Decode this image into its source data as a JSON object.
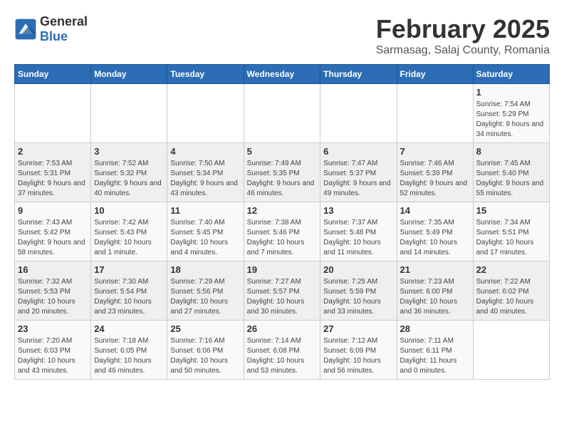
{
  "header": {
    "logo": {
      "general": "General",
      "blue": "Blue"
    },
    "title": "February 2025",
    "location": "Sarmasag, Salaj County, Romania"
  },
  "calendar": {
    "days_of_week": [
      "Sunday",
      "Monday",
      "Tuesday",
      "Wednesday",
      "Thursday",
      "Friday",
      "Saturday"
    ],
    "weeks": [
      [
        {
          "day": "",
          "info": ""
        },
        {
          "day": "",
          "info": ""
        },
        {
          "day": "",
          "info": ""
        },
        {
          "day": "",
          "info": ""
        },
        {
          "day": "",
          "info": ""
        },
        {
          "day": "",
          "info": ""
        },
        {
          "day": "1",
          "info": "Sunrise: 7:54 AM\nSunset: 5:29 PM\nDaylight: 9 hours and 34 minutes."
        }
      ],
      [
        {
          "day": "2",
          "info": "Sunrise: 7:53 AM\nSunset: 5:31 PM\nDaylight: 9 hours and 37 minutes."
        },
        {
          "day": "3",
          "info": "Sunrise: 7:52 AM\nSunset: 5:32 PM\nDaylight: 9 hours and 40 minutes."
        },
        {
          "day": "4",
          "info": "Sunrise: 7:50 AM\nSunset: 5:34 PM\nDaylight: 9 hours and 43 minutes."
        },
        {
          "day": "5",
          "info": "Sunrise: 7:49 AM\nSunset: 5:35 PM\nDaylight: 9 hours and 46 minutes."
        },
        {
          "day": "6",
          "info": "Sunrise: 7:47 AM\nSunset: 5:37 PM\nDaylight: 9 hours and 49 minutes."
        },
        {
          "day": "7",
          "info": "Sunrise: 7:46 AM\nSunset: 5:39 PM\nDaylight: 9 hours and 52 minutes."
        },
        {
          "day": "8",
          "info": "Sunrise: 7:45 AM\nSunset: 5:40 PM\nDaylight: 9 hours and 55 minutes."
        }
      ],
      [
        {
          "day": "9",
          "info": "Sunrise: 7:43 AM\nSunset: 5:42 PM\nDaylight: 9 hours and 58 minutes."
        },
        {
          "day": "10",
          "info": "Sunrise: 7:42 AM\nSunset: 5:43 PM\nDaylight: 10 hours and 1 minute."
        },
        {
          "day": "11",
          "info": "Sunrise: 7:40 AM\nSunset: 5:45 PM\nDaylight: 10 hours and 4 minutes."
        },
        {
          "day": "12",
          "info": "Sunrise: 7:38 AM\nSunset: 5:46 PM\nDaylight: 10 hours and 7 minutes."
        },
        {
          "day": "13",
          "info": "Sunrise: 7:37 AM\nSunset: 5:48 PM\nDaylight: 10 hours and 11 minutes."
        },
        {
          "day": "14",
          "info": "Sunrise: 7:35 AM\nSunset: 5:49 PM\nDaylight: 10 hours and 14 minutes."
        },
        {
          "day": "15",
          "info": "Sunrise: 7:34 AM\nSunset: 5:51 PM\nDaylight: 10 hours and 17 minutes."
        }
      ],
      [
        {
          "day": "16",
          "info": "Sunrise: 7:32 AM\nSunset: 5:53 PM\nDaylight: 10 hours and 20 minutes."
        },
        {
          "day": "17",
          "info": "Sunrise: 7:30 AM\nSunset: 5:54 PM\nDaylight: 10 hours and 23 minutes."
        },
        {
          "day": "18",
          "info": "Sunrise: 7:29 AM\nSunset: 5:56 PM\nDaylight: 10 hours and 27 minutes."
        },
        {
          "day": "19",
          "info": "Sunrise: 7:27 AM\nSunset: 5:57 PM\nDaylight: 10 hours and 30 minutes."
        },
        {
          "day": "20",
          "info": "Sunrise: 7:25 AM\nSunset: 5:59 PM\nDaylight: 10 hours and 33 minutes."
        },
        {
          "day": "21",
          "info": "Sunrise: 7:23 AM\nSunset: 6:00 PM\nDaylight: 10 hours and 36 minutes."
        },
        {
          "day": "22",
          "info": "Sunrise: 7:22 AM\nSunset: 6:02 PM\nDaylight: 10 hours and 40 minutes."
        }
      ],
      [
        {
          "day": "23",
          "info": "Sunrise: 7:20 AM\nSunset: 6:03 PM\nDaylight: 10 hours and 43 minutes."
        },
        {
          "day": "24",
          "info": "Sunrise: 7:18 AM\nSunset: 6:05 PM\nDaylight: 10 hours and 46 minutes."
        },
        {
          "day": "25",
          "info": "Sunrise: 7:16 AM\nSunset: 6:06 PM\nDaylight: 10 hours and 50 minutes."
        },
        {
          "day": "26",
          "info": "Sunrise: 7:14 AM\nSunset: 6:08 PM\nDaylight: 10 hours and 53 minutes."
        },
        {
          "day": "27",
          "info": "Sunrise: 7:12 AM\nSunset: 6:09 PM\nDaylight: 10 hours and 56 minutes."
        },
        {
          "day": "28",
          "info": "Sunrise: 7:11 AM\nSunset: 6:11 PM\nDaylight: 11 hours and 0 minutes."
        },
        {
          "day": "",
          "info": ""
        }
      ]
    ]
  }
}
